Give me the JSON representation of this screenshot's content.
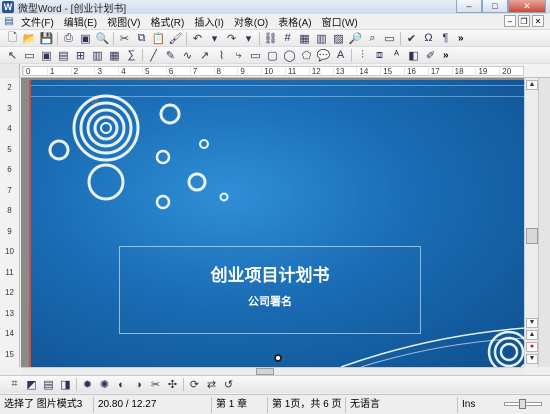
{
  "window": {
    "title": "微型Word - [创业计划书]",
    "app_icon": "W",
    "controls": [
      "minimize-icon",
      "maximize-icon",
      "close-icon"
    ]
  },
  "menubar": {
    "items": [
      "文件(F)",
      "编辑(E)",
      "视图(V)",
      "格式(R)",
      "插入(I)",
      "对象(O)",
      "表格(A)",
      "窗口(W)"
    ]
  },
  "toolbar_more": "»",
  "rulers": {
    "horizontal_ticks": [
      "0",
      "1",
      "2",
      "3",
      "4",
      "5",
      "6",
      "7",
      "8",
      "9",
      "10",
      "11",
      "12",
      "13",
      "14",
      "15",
      "16",
      "17",
      "18",
      "19",
      "20"
    ],
    "vertical_ticks": [
      "2",
      "3",
      "4",
      "5",
      "6",
      "7",
      "8",
      "9",
      "10",
      "11",
      "12",
      "13",
      "14",
      "15"
    ]
  },
  "slide": {
    "title": "创业项目计划书",
    "subtitle": "公司署名",
    "colors": {
      "background": "#1a6cb4",
      "border_accent": "#d24d3a"
    }
  },
  "statusbar": {
    "mode": "选择了 图片模式3",
    "position": "20.80 / 12.27",
    "chapter": "第 1 章",
    "page": "第 1页，共 6 页",
    "language": "无语言",
    "ins": "Ins"
  }
}
